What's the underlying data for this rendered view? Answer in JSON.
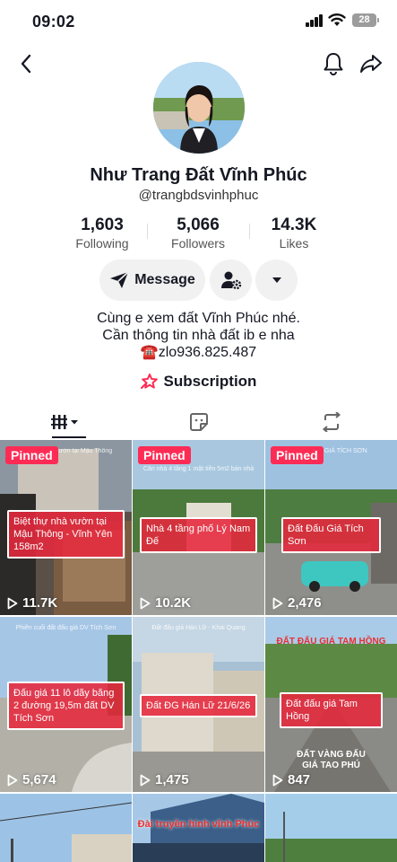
{
  "status_bar": {
    "time": "09:02",
    "battery": "28"
  },
  "profile": {
    "name": "Như Trang Đất Vĩnh Phúc",
    "handle": "@trangbdsvinhphuc",
    "stats": [
      {
        "value": "1,603",
        "label": "Following"
      },
      {
        "value": "5,066",
        "label": "Followers"
      },
      {
        "value": "14.3K",
        "label": "Likes"
      }
    ],
    "message_label": "Message",
    "bio_lines": [
      "Cùng e xem đất Vĩnh Phúc nhé.",
      "Cần thông tin nhà đất ib e nha",
      "☎️zlo936.825.487"
    ],
    "subscription_label": "Subscription"
  },
  "colors": {
    "accent": "#fe2c55",
    "caption_bg": "#e6283c"
  },
  "videos": [
    {
      "pinned": "Pinned",
      "caption": "Biệt thự nhà vườn tại Mậu Thông - Vĩnh Yên 158m2",
      "views": "11.7K",
      "note": "Biệt thự nhà vườn tại Mậu Thông"
    },
    {
      "pinned": "Pinned",
      "caption": "Nhà 4 tầng phố Lý Nam Đế",
      "views": "10.2K",
      "note": "Căn nhà 4 tầng 1 mặt tiền 5m2 bán nhà"
    },
    {
      "pinned": "Pinned",
      "caption": "Đất Đấu Giá Tích Sơn",
      "views": "2,476",
      "note": "ĐẤT ĐẤU GIÁ TÍCH SƠN"
    },
    {
      "caption": "Đấu giá 11 lô dãy băng 2 đường 19,5m đất DV Tích Sơn",
      "views": "5,674",
      "note": "Phiên cuối đất đấu giá DV Tích Sơn"
    },
    {
      "caption": "Đất ĐG Hán Lữ 21/6/26",
      "views": "1,475",
      "note": "Đất đấu giá Hán Lữ - Khai Quang"
    },
    {
      "caption": "Đất đấu giá Tam Hồng",
      "views": "847",
      "note": "ĐẤT ĐẤU GIÁ TAM HỒNG",
      "bottom_text": "ĐẤT VÀNG ĐẤU GIÁ TAO PHÚ"
    },
    {
      "caption": "",
      "views": "",
      "note": ""
    },
    {
      "caption": "",
      "views": "",
      "note": "",
      "title": "Đài truyền hình vĩnh Phúc"
    },
    {
      "caption": "",
      "views": "",
      "note": ""
    }
  ]
}
